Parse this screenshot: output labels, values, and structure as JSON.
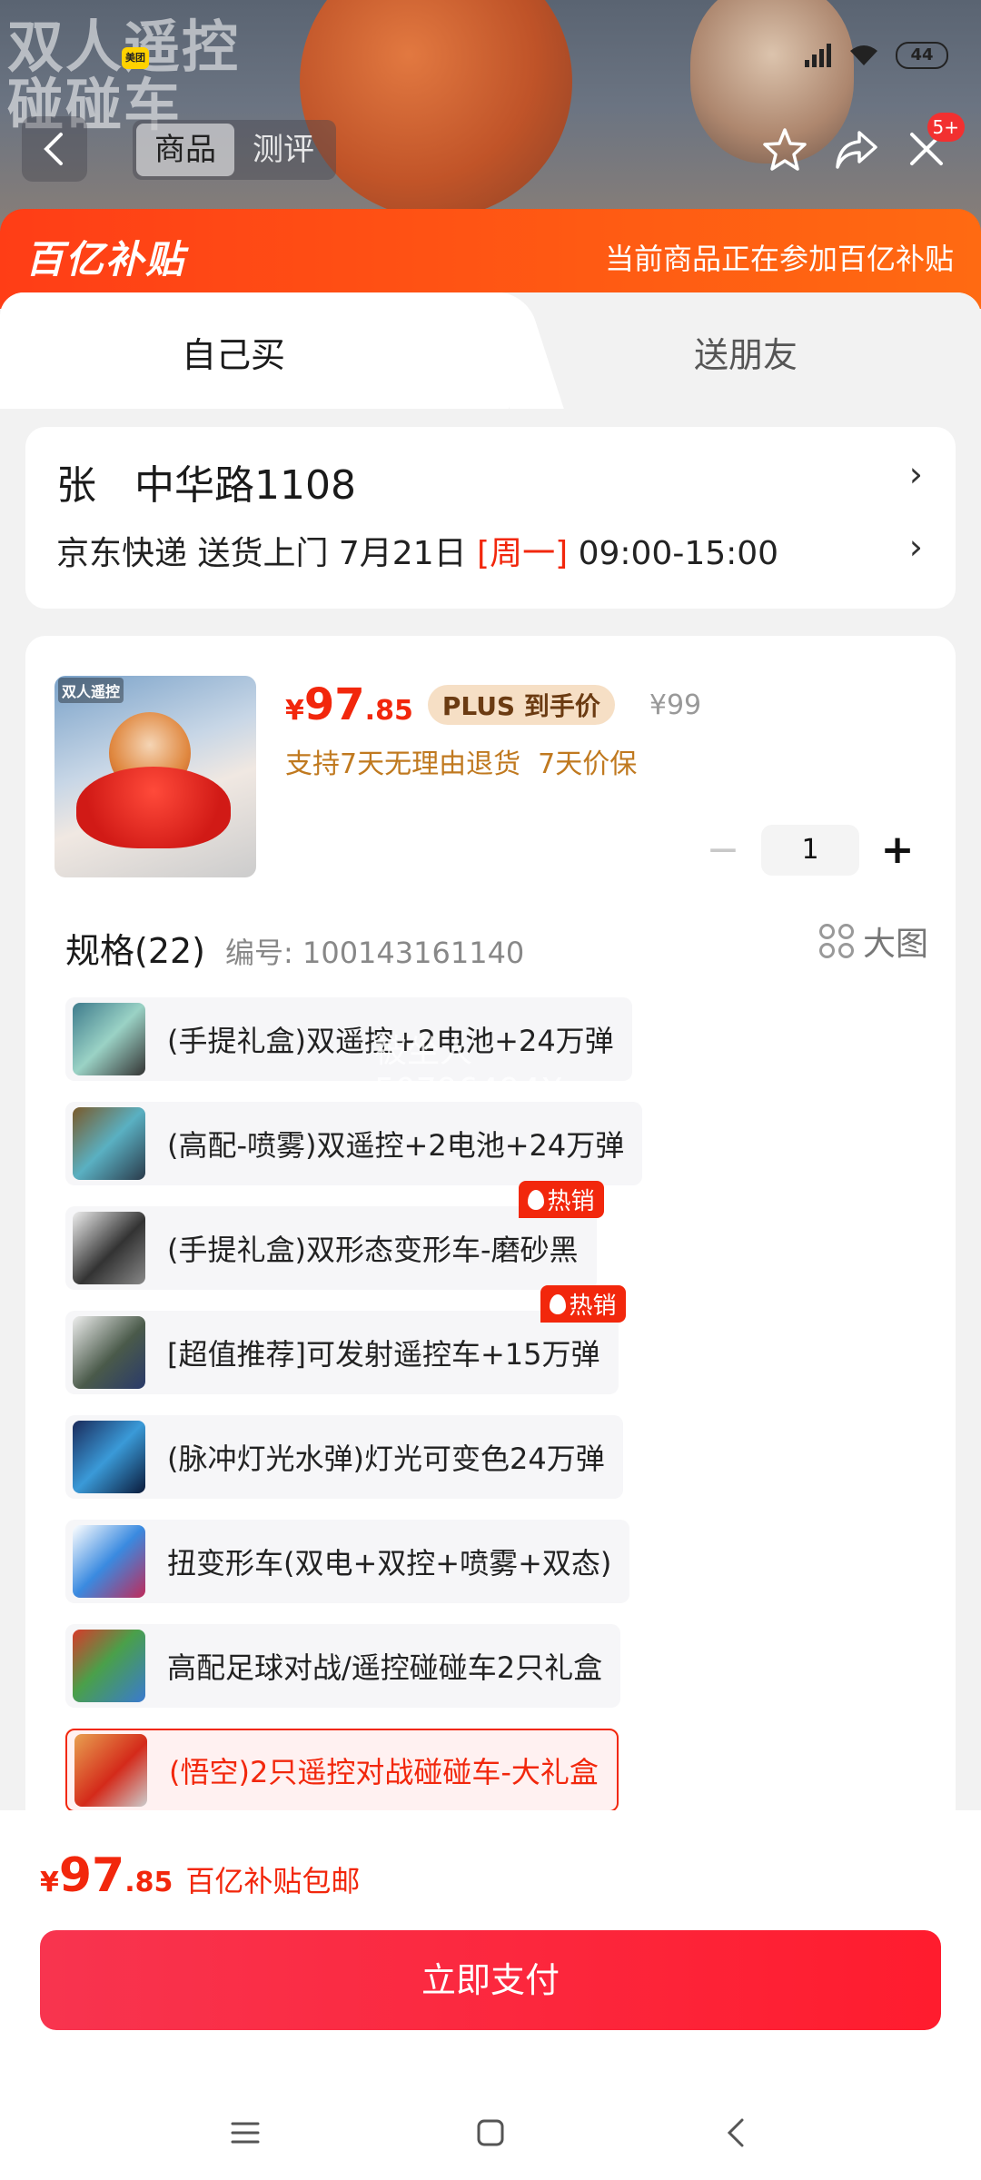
{
  "background": {
    "title": "双人遥控\n碰碰车",
    "status": {
      "app_badge": "美团",
      "battery": "44"
    }
  },
  "top_nav": {
    "tabs": [
      {
        "label": "商品"
      },
      {
        "label": "测评"
      }
    ],
    "notification_count": "5+"
  },
  "banner": {
    "logo": "百亿补贴",
    "text": "当前商品正在参加百亿补贴"
  },
  "mode_tabs": {
    "self": "自己买",
    "friend": "送朋友"
  },
  "address": {
    "line1": "张   中华路1108",
    "delivery_prefix": "京东快递 送货上门 7月21日 ",
    "delivery_day": "[周一]",
    "delivery_time": " 09:00-15:00"
  },
  "product": {
    "image_caption": "双人遥控",
    "price_symbol": "¥",
    "price_int": "97",
    "price_dec": ".85",
    "plus_label": "PLUS 到手价",
    "original_price": "¥99",
    "support": "支持7天无理由退货  7天价保",
    "quantity": "1"
  },
  "spec": {
    "title": "规格(22)",
    "code": "编号: 100143161140",
    "big_image": "大图",
    "items": [
      {
        "label": "(手提礼盒)双遥控+2电池+24万弹",
        "hot": ""
      },
      {
        "label": "(高配-喷雾)双遥控+2电池+24万弹",
        "hot": ""
      },
      {
        "label": "(手提礼盒)双形态变形车-磨砂黑",
        "hot": "热销"
      },
      {
        "label": "[超值推荐]可发射遥控车+15万弹",
        "hot": "热销"
      },
      {
        "label": "(脉冲灯光水弹)灯光可变色24万弹",
        "hot": ""
      },
      {
        "label": "扭变形车(双电+双控+喷雾+双态)",
        "hot": ""
      },
      {
        "label": "高配足球对战/遥控碰碰车2只礼盒",
        "hot": ""
      },
      {
        "label": "(悟空)2只遥控对战碰碰车-大礼盒",
        "hot": ""
      }
    ],
    "watermark": "被坐人50796494X"
  },
  "bottom": {
    "price_symbol": "¥",
    "price_int": "97",
    "price_dec": ".85",
    "free_ship": "百亿补贴包邮",
    "pay_label": "立即支付"
  },
  "colors": {
    "accent": "#f2270c",
    "banner": "#ff4a14",
    "pay": "#fb233f"
  }
}
